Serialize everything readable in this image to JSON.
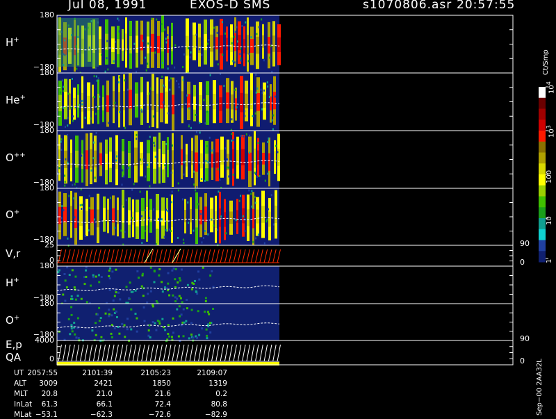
{
  "header": {
    "date": "Jul 08, 1991",
    "instrument": "EXOS-D SMS",
    "file": "s1070806.asr",
    "time": "20:57:55"
  },
  "panels": [
    {
      "label": "H",
      "charge": "+",
      "tick_top": "180",
      "tick_bottom": "−180"
    },
    {
      "label": "He",
      "charge": "+",
      "tick_top": "180",
      "tick_bottom": "−180"
    },
    {
      "label": "O",
      "charge": "++",
      "tick_top": "180",
      "tick_bottom": "−180"
    },
    {
      "label": "O",
      "charge": "+",
      "tick_top": "180",
      "tick_bottom": "−180"
    },
    {
      "label": "V,r",
      "charge": "",
      "tick_top": "25",
      "tick_bottom": "0",
      "right_top": "90",
      "right_bottom": "0"
    },
    {
      "label": "H",
      "charge": "+",
      "tick_top": "180",
      "tick_bottom": "−180"
    },
    {
      "label": "O",
      "charge": "+",
      "tick_top": "180",
      "tick_bottom": "−180"
    },
    {
      "label": "E,p",
      "label2": "QA",
      "charge": "",
      "tick_top": "4000",
      "tick_bottom": "0",
      "right_top": "90",
      "right_bottom": "0"
    }
  ],
  "colorbar": {
    "unit": "Ct/Smp",
    "labels": [
      {
        "text": "10",
        "exp": "4",
        "frac": 0.0
      },
      {
        "text": "10",
        "exp": "3",
        "frac": 0.25
      },
      {
        "text": "100",
        "exp": "",
        "frac": 0.5
      },
      {
        "text": "10",
        "exp": "",
        "frac": 0.75
      },
      {
        "text": "1",
        "exp": "",
        "frac": 0.98
      }
    ],
    "colors": [
      "#ffffff",
      "#6a0000",
      "#a00000",
      "#d00000",
      "#ff1a00",
      "#8a7000",
      "#b0a000",
      "#d8d800",
      "#ffff00",
      "#9ad000",
      "#40c000",
      "#1aa01a",
      "#10a090",
      "#10d0d0",
      "#2040a0",
      "#102070"
    ]
  },
  "time_axis": {
    "rows": [
      {
        "name": "UT",
        "values": [
          "2057:55",
          "2101:39",
          "2105:23",
          "2109:07"
        ]
      },
      {
        "name": "ALT",
        "values": [
          "3009",
          "2421",
          "1850",
          "1319"
        ]
      },
      {
        "name": "MLT",
        "values": [
          "20.8",
          "21.0",
          "21.6",
          "0.2"
        ]
      },
      {
        "name": "InLat",
        "values": [
          "61.3",
          "66.1",
          "72.4",
          "80.8"
        ]
      },
      {
        "name": "MLat",
        "values": [
          "−53.1",
          "−62.3",
          "−72.6",
          "−82.9"
        ]
      }
    ]
  },
  "footer_note": "Sep−00 2AA32L",
  "chart_data": [
    {
      "type": "heatmap",
      "title": "H+",
      "ylim": [
        -180,
        180
      ],
      "data_coverage_fraction": 0.45
    },
    {
      "type": "heatmap",
      "title": "He+",
      "ylim": [
        -180,
        180
      ],
      "data_coverage_fraction": 0.45
    },
    {
      "type": "heatmap",
      "title": "O++",
      "ylim": [
        -180,
        180
      ],
      "data_coverage_fraction": 0.45
    },
    {
      "type": "heatmap",
      "title": "O+",
      "ylim": [
        -180,
        180
      ],
      "data_coverage_fraction": 0.45
    },
    {
      "type": "line",
      "title": "V,r",
      "ylim": [
        0,
        25
      ],
      "y2lim": [
        0,
        90
      ]
    },
    {
      "type": "heatmap",
      "title": "H+",
      "ylim": [
        -180,
        180
      ],
      "data_coverage_fraction": 0.45
    },
    {
      "type": "heatmap",
      "title": "O+",
      "ylim": [
        -180,
        180
      ],
      "data_coverage_fraction": 0.45
    },
    {
      "type": "line",
      "title": "E,p / QA",
      "ylim": [
        0,
        4000
      ],
      "y2lim": [
        0,
        90
      ]
    }
  ]
}
